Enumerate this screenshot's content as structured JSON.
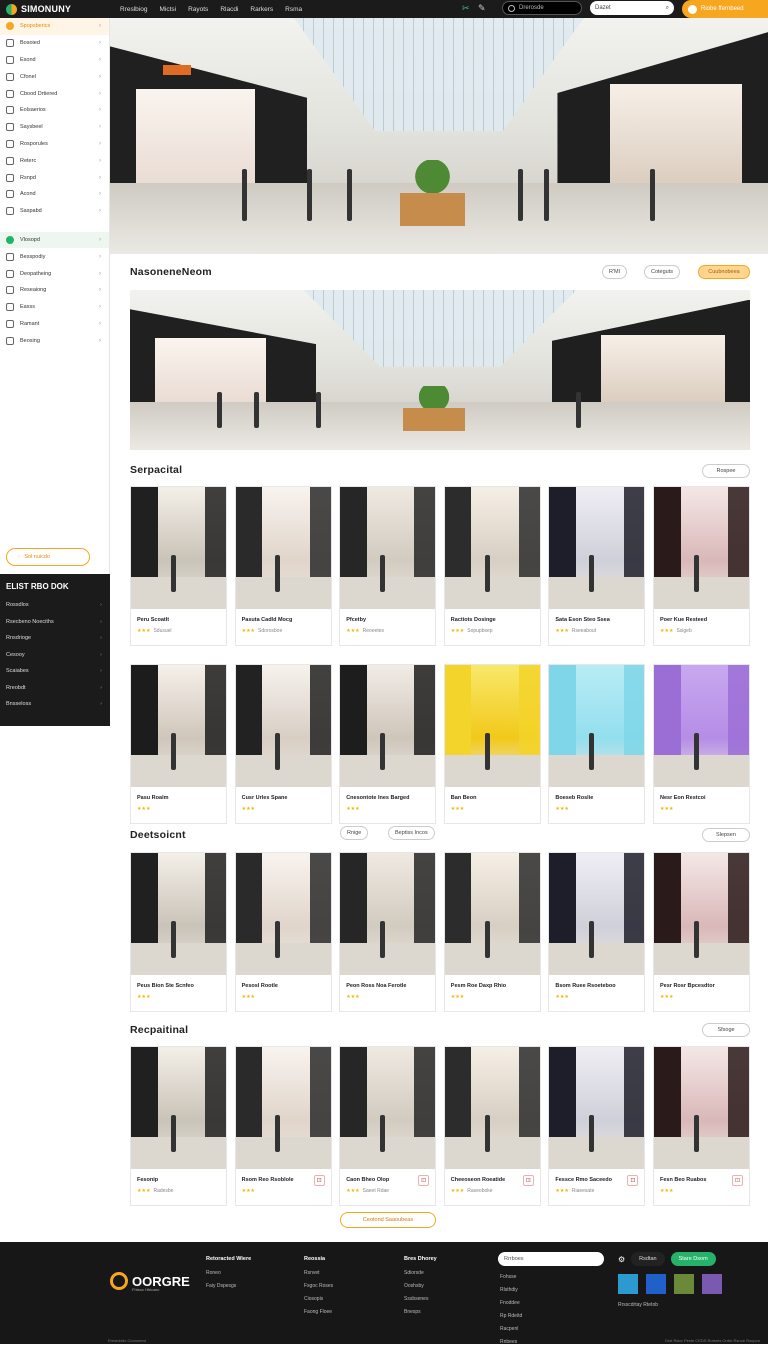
{
  "app": {
    "name": "SIMONUNY"
  },
  "topnav": [
    "Rreslbiog",
    "Mictsi",
    "Rayots",
    "Rlacdi",
    "Rarkers",
    "Rsma"
  ],
  "top_search_placeholder": "Drerosde",
  "top_search2_placeholder": "Dazet",
  "top_cta": "Riobe ffernbeed",
  "sidebar": {
    "items": [
      {
        "label": "Spopsberics",
        "active": true
      },
      {
        "label": "Bosoied"
      },
      {
        "label": "Esond"
      },
      {
        "label": "Cfonel"
      },
      {
        "label": "Cbood Drtiered"
      },
      {
        "label": "Eolsaerios"
      },
      {
        "label": "Saysbeel"
      },
      {
        "label": "Rosporules"
      },
      {
        "label": "Reterc"
      },
      {
        "label": "Rsnpd"
      },
      {
        "label": "Acond"
      },
      {
        "label": "Saspabd"
      },
      {
        "label": "Vlosopd",
        "selected": true
      },
      {
        "label": "Besspodiy"
      },
      {
        "label": "Deopatheing"
      },
      {
        "label": "Reseaiong"
      },
      {
        "label": "Eaxss"
      },
      {
        "label": "Ramant"
      },
      {
        "label": "Beosing"
      }
    ],
    "pill": "Sol nuicdo",
    "dark_title": "ELIST RBO DOK",
    "dark_rows": [
      "Rossdlos",
      "Rsecbeno Noeciths",
      "Rnsdrioge",
      "Cesooy",
      "Scaiabes",
      "Rreobdt",
      "Bnsseloss"
    ]
  },
  "featured": {
    "title": "NasoneneNeom",
    "chips": [
      "R'MI",
      "Coteguts",
      "Cuubnobeea"
    ]
  },
  "special": {
    "title": "Serpacital",
    "more": "Rospee",
    "row1": [
      {
        "t": "Peru Scoatlt",
        "s": "Sdusuel"
      },
      {
        "t": "Pasuta Cadld Mocg",
        "s": "Sdorosboe"
      },
      {
        "t": "Pfcetby",
        "s": "Reoeetes"
      },
      {
        "t": "Ractiots Dosinge",
        "s": "Sopupbsep"
      },
      {
        "t": "Sata Eson Steo Ssea",
        "s": "Rseeabout"
      },
      {
        "t": "Poer Kue Resteed",
        "s": "Ssigeb"
      }
    ],
    "row2": [
      {
        "t": "Pasu Roalm",
        "s": ""
      },
      {
        "t": "Cusr Urles Spane",
        "s": ""
      },
      {
        "t": "Cnesontote Ines Barged",
        "s": ""
      },
      {
        "t": "Ban Beon",
        "s": ""
      },
      {
        "t": "Boeseb Roslie",
        "s": ""
      },
      {
        "t": "Nesr Eon Restcoi",
        "s": ""
      }
    ]
  },
  "destination": {
    "title": "Deetsoicnt",
    "chips": [
      "Rnige",
      "Beptiss Incos"
    ],
    "more": "Slepsen",
    "row": [
      {
        "t": "Peus Bion Ste Scnfeo",
        "s": ""
      },
      {
        "t": "Pesosl Rootle",
        "s": ""
      },
      {
        "t": "Peon Ross Noa Ferotle",
        "s": ""
      },
      {
        "t": "Pesm Roe Daxp Rhio",
        "s": ""
      },
      {
        "t": "Bsom Ruee Rsoeteboo",
        "s": ""
      },
      {
        "t": "Pesr Rosr Bpcesdtor",
        "s": ""
      }
    ]
  },
  "recent": {
    "title": "Recpaitinal",
    "more": "Sfsoge",
    "row": [
      {
        "t": "Fesonip",
        "s": "Radesbe"
      },
      {
        "t": "Rsom Reo Rsoblole",
        "s": ""
      },
      {
        "t": "Caon Bheo Olop",
        "s": "Saeet Rdae"
      },
      {
        "t": "Cheeoseon Roeatide",
        "s": "Raseoboke"
      },
      {
        "t": "Fessce Rmo Saceedo",
        "s": "Riaeesate"
      },
      {
        "t": "Fesn Beo Ruabos",
        "s": ""
      }
    ],
    "load_more": "Ceotond Saaoubeas"
  },
  "footer": {
    "brand": "OORGRE",
    "brand_sub": "Fhtsoc Hbtoaro",
    "col1": {
      "title": "Retoracted Wiere",
      "items": [
        "Roneo",
        "Faiy Dspesgs"
      ]
    },
    "col2": {
      "title": "Reossia",
      "items": [
        "Rsnvet",
        "Fsgoc Roses",
        "Ciosopis",
        "Faong Floee"
      ]
    },
    "col3": {
      "title": "Bres Dhorey",
      "items": [
        "Sdiorsde",
        "Ooshsby",
        "Sssbsenes",
        "Bnesps"
      ]
    },
    "input_placeholder": "Rrrboes",
    "links": [
      "Fohsse",
      "Rlsthdiy",
      "Fnoddee",
      "Rp Rdeitd",
      "Racpenl",
      "Rnbees"
    ],
    "social_pill1": "Rsdtan",
    "social_pill2": "Stare Dsom",
    "foot_text": "Rrsscdrtay Rtetob",
    "bottom_left": "Erestolstic Clonomed",
    "bottom_right": "Dsrt Rslor Peste CEDS Rotsres Ordte Rsnoe Rocpon"
  }
}
